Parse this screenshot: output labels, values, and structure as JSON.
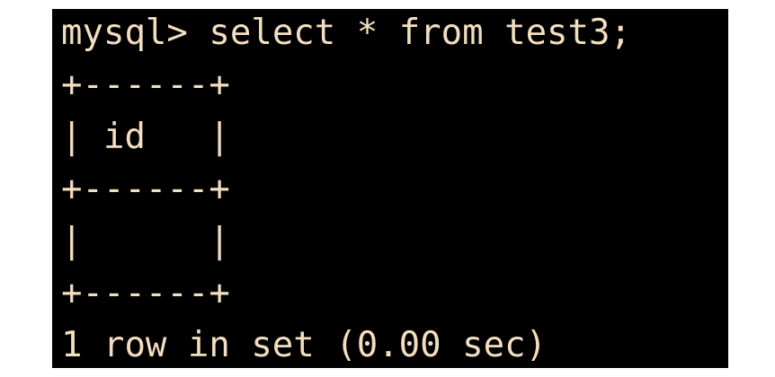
{
  "terminal": {
    "colors": {
      "background": "#000000",
      "text": "#f3dec0"
    },
    "prompt": "mysql>",
    "command": "select * from test3;",
    "table": {
      "border_top": "+------+",
      "header_row": "| id   |",
      "border_mid": "+------+",
      "data_row": "|      |",
      "border_bottom": "+------+"
    },
    "result": "1 row in set (0.00 sec)"
  }
}
